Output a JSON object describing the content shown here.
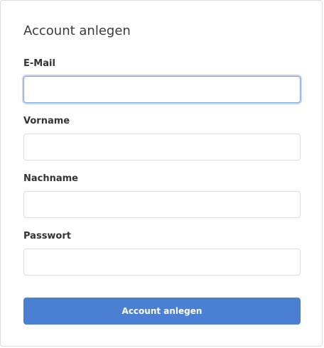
{
  "form": {
    "title": "Account anlegen",
    "fields": [
      {
        "label": "E-Mail",
        "value": "",
        "placeholder": "",
        "focused": true
      },
      {
        "label": "Vorname",
        "value": "",
        "placeholder": "",
        "focused": false
      },
      {
        "label": "Nachname",
        "value": "",
        "placeholder": "",
        "focused": false
      },
      {
        "label": "Passwort",
        "value": "",
        "placeholder": "",
        "focused": false
      }
    ],
    "submit_label": "Account anlegen"
  },
  "colors": {
    "accent": "#4a7fd1",
    "focus_ring": "#7ea7dd",
    "border": "#dcdcdc"
  }
}
